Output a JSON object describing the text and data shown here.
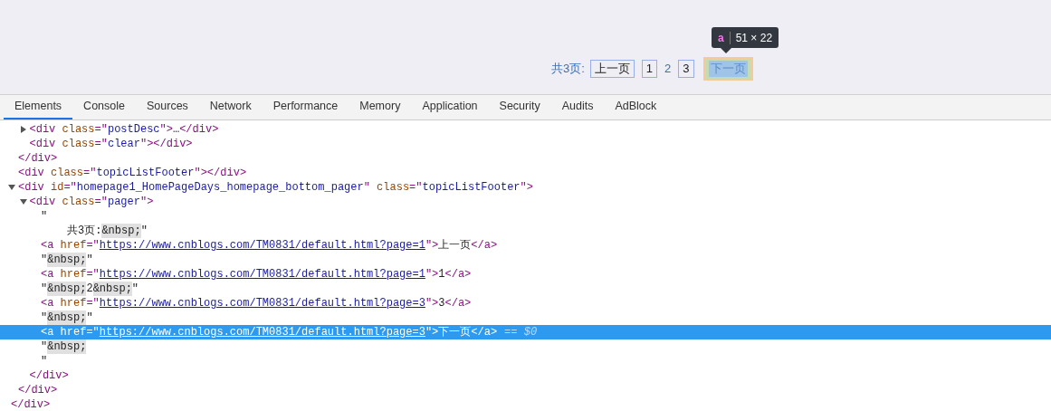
{
  "preview": {
    "pager": {
      "label": "共3页:",
      "items": [
        {
          "text": "上一页",
          "kind": "link"
        },
        {
          "text": "1",
          "kind": "link"
        },
        {
          "text": "2",
          "kind": "current"
        },
        {
          "text": "3",
          "kind": "link"
        },
        {
          "text": "下一页",
          "kind": "inspected"
        }
      ]
    },
    "tooltip": {
      "tag": "a",
      "size": "51 × 22"
    }
  },
  "tabs": [
    {
      "label": "Elements",
      "selected": true
    },
    {
      "label": "Console",
      "selected": false
    },
    {
      "label": "Sources",
      "selected": false
    },
    {
      "label": "Network",
      "selected": false
    },
    {
      "label": "Performance",
      "selected": false
    },
    {
      "label": "Memory",
      "selected": false
    },
    {
      "label": "Application",
      "selected": false
    },
    {
      "label": "Security",
      "selected": false
    },
    {
      "label": "Audits",
      "selected": false
    },
    {
      "label": "AdBlock",
      "selected": false
    }
  ],
  "dom": [
    {
      "children": [
        {
          "children": [
            {
              "expanded": false,
              "selected": false,
              "tokens": [
                {
                  "kind": "tag",
                  "text": "<div"
                },
                {
                  "kind": "attr",
                  "text": " class"
                },
                {
                  "kind": "tag",
                  "text": "=\""
                },
                {
                  "kind": "value",
                  "text": "postDesc"
                },
                {
                  "kind": "tag",
                  "text": "\">"
                },
                {
                  "kind": "text",
                  "text": "…"
                },
                {
                  "kind": "tag",
                  "text": "</div>"
                }
              ]
            },
            {
              "selected": false,
              "tokens": [
                {
                  "kind": "tag",
                  "text": "<div"
                },
                {
                  "kind": "attr",
                  "text": " class"
                },
                {
                  "kind": "tag",
                  "text": "=\""
                },
                {
                  "kind": "value",
                  "text": "clear"
                },
                {
                  "kind": "tag",
                  "text": "\"></div>"
                }
              ]
            }
          ]
        },
        {
          "selected": false,
          "tokens": [
            {
              "kind": "tag",
              "text": "</div>"
            }
          ]
        },
        {
          "selected": false,
          "tokens": [
            {
              "kind": "tag",
              "text": "<div"
            },
            {
              "kind": "attr",
              "text": " class"
            },
            {
              "kind": "tag",
              "text": "=\""
            },
            {
              "kind": "value",
              "text": "topicListFooter"
            },
            {
              "kind": "tag",
              "text": "\"></div>"
            }
          ]
        },
        {
          "expanded": true,
          "selected": false,
          "tokens": [
            {
              "kind": "tag",
              "text": "<div"
            },
            {
              "kind": "attr",
              "text": " id"
            },
            {
              "kind": "tag",
              "text": "=\""
            },
            {
              "kind": "value",
              "text": "homepage1_HomePageDays_homepage_bottom_pager"
            },
            {
              "kind": "tag",
              "text": "\""
            },
            {
              "kind": "attr",
              "text": " class"
            },
            {
              "kind": "tag",
              "text": "=\""
            },
            {
              "kind": "value",
              "text": "topicListFooter"
            },
            {
              "kind": "tag",
              "text": "\">"
            }
          ],
          "children": [
            {
              "expanded": true,
              "selected": false,
              "tokens": [
                {
                  "kind": "tag",
                  "text": "<div"
                },
                {
                  "kind": "attr",
                  "text": " class"
                },
                {
                  "kind": "tag",
                  "text": "=\""
                },
                {
                  "kind": "value",
                  "text": "pager"
                },
                {
                  "kind": "tag",
                  "text": "\">"
                }
              ],
              "children": [
                {
                  "selected": false,
                  "tokens": [
                    {
                      "kind": "text",
                      "text": "\""
                    }
                  ]
                },
                {
                  "selected": false,
                  "wrapped": true,
                  "tokens": [
                    {
                      "kind": "text",
                      "text": "共3页:"
                    },
                    {
                      "kind": "entity",
                      "text": "&nbsp;"
                    },
                    {
                      "kind": "text",
                      "text": "\""
                    }
                  ]
                },
                {
                  "selected": false,
                  "tokens": [
                    {
                      "kind": "tag",
                      "text": "<a"
                    },
                    {
                      "kind": "attr",
                      "text": " href"
                    },
                    {
                      "kind": "tag",
                      "text": "=\""
                    },
                    {
                      "kind": "link",
                      "text": "https://www.cnblogs.com/TM0831/default.html?page=1"
                    },
                    {
                      "kind": "tag",
                      "text": "\">"
                    },
                    {
                      "kind": "text",
                      "text": "上一页"
                    },
                    {
                      "kind": "tag",
                      "text": "</a>"
                    }
                  ]
                },
                {
                  "selected": false,
                  "tokens": [
                    {
                      "kind": "text",
                      "text": "\""
                    },
                    {
                      "kind": "entity",
                      "text": "&nbsp;"
                    },
                    {
                      "kind": "text",
                      "text": "\""
                    }
                  ]
                },
                {
                  "selected": false,
                  "tokens": [
                    {
                      "kind": "tag",
                      "text": "<a"
                    },
                    {
                      "kind": "attr",
                      "text": " href"
                    },
                    {
                      "kind": "tag",
                      "text": "=\""
                    },
                    {
                      "kind": "link",
                      "text": "https://www.cnblogs.com/TM0831/default.html?page=1"
                    },
                    {
                      "kind": "tag",
                      "text": "\">"
                    },
                    {
                      "kind": "text",
                      "text": "1"
                    },
                    {
                      "kind": "tag",
                      "text": "</a>"
                    }
                  ]
                },
                {
                  "selected": false,
                  "tokens": [
                    {
                      "kind": "text",
                      "text": "\""
                    },
                    {
                      "kind": "entity",
                      "text": "&nbsp;"
                    },
                    {
                      "kind": "text",
                      "text": "2"
                    },
                    {
                      "kind": "entity",
                      "text": "&nbsp;"
                    },
                    {
                      "kind": "text",
                      "text": "\""
                    }
                  ]
                },
                {
                  "selected": false,
                  "tokens": [
                    {
                      "kind": "tag",
                      "text": "<a"
                    },
                    {
                      "kind": "attr",
                      "text": " href"
                    },
                    {
                      "kind": "tag",
                      "text": "=\""
                    },
                    {
                      "kind": "link",
                      "text": "https://www.cnblogs.com/TM0831/default.html?page=3"
                    },
                    {
                      "kind": "tag",
                      "text": "\">"
                    },
                    {
                      "kind": "text",
                      "text": "3"
                    },
                    {
                      "kind": "tag",
                      "text": "</a>"
                    }
                  ]
                },
                {
                  "selected": false,
                  "tokens": [
                    {
                      "kind": "text",
                      "text": "\""
                    },
                    {
                      "kind": "entity",
                      "text": "&nbsp;"
                    },
                    {
                      "kind": "text",
                      "text": "\""
                    }
                  ]
                },
                {
                  "selected": true,
                  "tokens": [
                    {
                      "kind": "tag",
                      "text": "<a"
                    },
                    {
                      "kind": "attr",
                      "text": " href"
                    },
                    {
                      "kind": "tag",
                      "text": "=\""
                    },
                    {
                      "kind": "link",
                      "text": "https://www.cnblogs.com/TM0831/default.html?page=3"
                    },
                    {
                      "kind": "tag",
                      "text": "\">"
                    },
                    {
                      "kind": "text",
                      "text": "下一页"
                    },
                    {
                      "kind": "tag",
                      "text": "</a>"
                    },
                    {
                      "kind": "hint",
                      "text": "== $0"
                    }
                  ]
                },
                {
                  "selected": false,
                  "tokens": [
                    {
                      "kind": "text",
                      "text": "\""
                    },
                    {
                      "kind": "entity",
                      "text": "&nbsp;"
                    }
                  ]
                },
                {
                  "selected": false,
                  "tokens": [
                    {
                      "kind": "text",
                      "text": "\""
                    }
                  ]
                }
              ]
            },
            {
              "selected": false,
              "tokens": [
                {
                  "kind": "tag",
                  "text": "</div>"
                }
              ]
            }
          ]
        },
        {
          "selected": false,
          "tokens": [
            {
              "kind": "tag",
              "text": "</div>"
            }
          ]
        }
      ]
    },
    {
      "selected": false,
      "tokens": [
        {
          "kind": "tag",
          "text": "</div>"
        }
      ]
    }
  ]
}
